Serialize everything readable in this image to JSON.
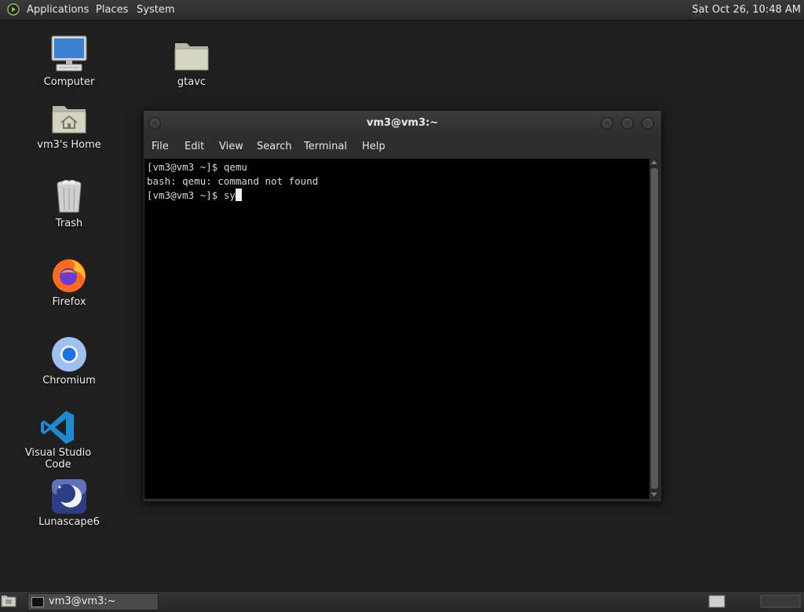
{
  "top_panel": {
    "menus": [
      "Applications",
      "Places",
      "System"
    ],
    "clock": "Sat Oct 26, 10:48 AM"
  },
  "desktop": {
    "icons": [
      {
        "label": "Computer",
        "icon": "computer-icon"
      },
      {
        "label": "gtavc",
        "icon": "folder-icon"
      },
      {
        "label": "vm3's Home",
        "icon": "home-folder-icon"
      },
      {
        "label": "Trash",
        "icon": "trash-icon"
      },
      {
        "label": "Firefox",
        "icon": "firefox-icon"
      },
      {
        "label": "Chromium",
        "icon": "chromium-icon"
      },
      {
        "label": "Visual Studio Code",
        "icon": "vscode-icon"
      },
      {
        "label": "Lunascape6",
        "icon": "lunascape-icon"
      }
    ]
  },
  "terminal": {
    "title": "vm3@vm3:~",
    "menu": [
      "File",
      "Edit",
      "View",
      "Search",
      "Terminal",
      "Help"
    ],
    "lines": [
      "[vm3@vm3 ~]$ qemu",
      "bash: qemu: command not found",
      "[vm3@vm3 ~]$ sy"
    ]
  },
  "bottom_panel": {
    "tasks": [
      {
        "label": "vm3@vm3:~",
        "icon": "terminal-icon"
      }
    ]
  },
  "colors": {
    "desktop_bg": "#1f1f1f",
    "panel_bg": "#2b2b2b",
    "terminal_bg": "#000000",
    "terminal_fg": "#d8d8d8"
  }
}
